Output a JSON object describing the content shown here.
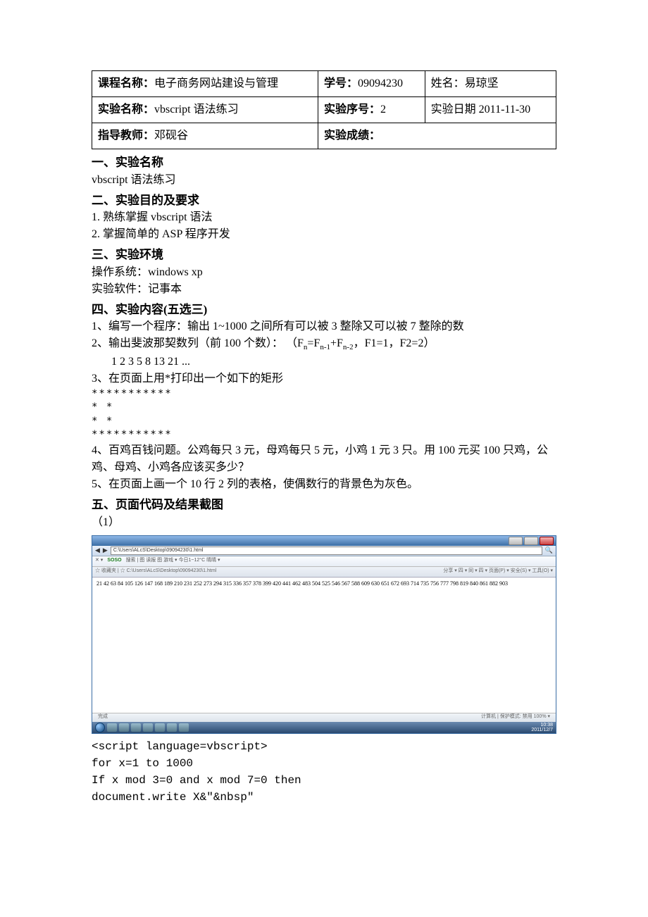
{
  "info_table": {
    "row1": {
      "c1_label": "课程名称：",
      "c1_value": "电子商务网站建设与管理",
      "c2_label": "学号：",
      "c2_value": "09094230",
      "c3_label": "姓名：",
      "c3_value": "易琼坚"
    },
    "row2": {
      "c1_label": "实验名称：",
      "c1_value": "vbscript 语法练习",
      "c2_label": "实验序号：",
      "c2_value": "2",
      "c3_label": "实验日期 ",
      "c3_value": "2011-11-30"
    },
    "row3": {
      "c1_label": "指导教师：",
      "c1_value": "邓砚谷",
      "c2_label": "实验成绩：",
      "c2_value": ""
    }
  },
  "sec1": {
    "heading": "一、实验名称",
    "body": "vbscript 语法练习"
  },
  "sec2": {
    "heading": "二、实验目的及要求",
    "l1": "1. 熟练掌握 vbscript 语法",
    "l2": "2. 掌握简单的 ASP 程序开发"
  },
  "sec3": {
    "heading": "三、实验环境",
    "l1": "操作系统：windows xp",
    "l2": "实验软件：记事本"
  },
  "sec4": {
    "heading": "四、实验内容(五选三)",
    "q1": "1、编写一个程序：输出 1~1000 之间所有可以被 3 整除又可以被 7 整除的数",
    "q2_a": "2、输出斐波那契数列（前 100 个数）：  （F",
    "q2_n": "n",
    "q2_b": "=F",
    "q2_n1": "n-1",
    "q2_c": "+F",
    "q2_n2": "n-2",
    "q2_d": "，F1=1，F2=2）",
    "q2_seq": "1  2  3  5  8  13  21 ...",
    "q3": "3、在页面上用*打印出一个如下的矩形",
    "stars_full": "***********",
    "stars_side": "*         *",
    "q4": "4、百鸡百钱问题。公鸡每只 3 元，母鸡每只 5 元，小鸡 1 元 3 只。用 100 元买 100 只鸡，公鸡、母鸡、小鸡各应该买多少？",
    "q5": "5、在页面上画一个 10 行 2 列的表格，使偶数行的背景色为灰色。"
  },
  "sec5": {
    "heading": "五、页面代码及结果截图",
    "sub1": "（1）"
  },
  "ie": {
    "url": "C:\\Users\\ALcS\\Desktop\\09094230\\1.html",
    "soso_label": "SOSO",
    "search_hint": "搜索  |  图 读报  图 游戏  ▾  今日1~12°C 晴晴 ▾",
    "tabs_hint": "☆ 收藏夹 | ☆   C:\\Users\\ALcS\\Desktop\\09094230\\1.html",
    "right_tools": "分享 ▾  四 ▾  同 ▾  四 ▾  页面(P) ▾  安全(S) ▾  工具(O) ▾",
    "output": "21 42 63 84 105 126 147 168 189 210 231 252 273 294 315 336 357 378 399 420 441 462 483 504 525 546 567 588 609 630 651 672 693 714 735 756 777 798 819 840 861 882 903",
    "status_left": "完成",
    "status_right": "计算机 | 保护模式: 禁用        100% ▾",
    "clock_time": "10:38",
    "clock_date": "2011/12/7"
  },
  "code": {
    "l1": "<script language=vbscript>",
    "l2": "for x=1 to 1000",
    "l3": "If x mod 3=0 and x mod 7=0 then",
    "l4": "document.write X&\"&nbsp\""
  }
}
